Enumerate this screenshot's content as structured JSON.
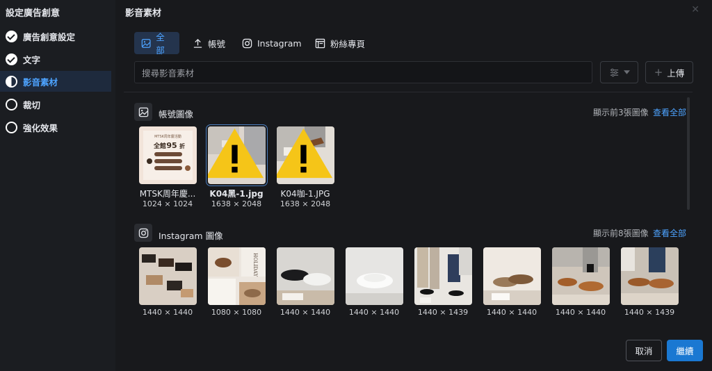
{
  "sidebar": {
    "title": "設定廣告創意",
    "steps": [
      {
        "label": "廣告創意設定",
        "state": "done"
      },
      {
        "label": "文字",
        "state": "done"
      },
      {
        "label": "影音素材",
        "state": "active"
      },
      {
        "label": "裁切",
        "state": "todo"
      },
      {
        "label": "強化效果",
        "state": "todo"
      }
    ]
  },
  "dialog": {
    "title": "影音素材",
    "close_icon": "close-icon",
    "tabs": [
      {
        "label": "全部",
        "icon": "image-icon",
        "active": true
      },
      {
        "label": "帳號",
        "icon": "upload-icon",
        "active": false
      },
      {
        "label": "Instagram",
        "icon": "instagram-icon",
        "active": false
      },
      {
        "label": "粉絲專頁",
        "icon": "page-icon",
        "active": false
      }
    ],
    "search": {
      "placeholder": "搜尋影音素材"
    },
    "filter_icon": "sliders-icon",
    "upload_label": "上傳",
    "accent_color": "#4da3ff",
    "primary_color": "#1a78d2",
    "warning_color": "#f5c518"
  },
  "sections": {
    "account": {
      "title": "帳號圖像",
      "count_text": "顯示前3張圖像",
      "view_all": "查看全部",
      "items": [
        {
          "name": "MTSK周年慶...",
          "dims": "1024 × 1024"
        },
        {
          "name": "K04黑-1.jpg",
          "dims": "1638 × 2048"
        },
        {
          "name": "K04咖-1.JPG",
          "dims": "1638 × 2048"
        }
      ]
    },
    "instagram": {
      "title": "Instagram 圖像",
      "count_text": "顯示前8張圖像",
      "view_all": "查看全部",
      "items": [
        {
          "dims": "1440 × 1440"
        },
        {
          "dims": "1080 × 1080"
        },
        {
          "dims": "1440 × 1440"
        },
        {
          "dims": "1440 × 1440"
        },
        {
          "dims": "1440 × 1439"
        },
        {
          "dims": "1440 × 1440"
        },
        {
          "dims": "1440 × 1440"
        },
        {
          "dims": "1440 × 1439"
        }
      ]
    }
  },
  "promo_thumb": {
    "brand": "MTSK周年慶活動",
    "headline_a": "全館",
    "headline_b": "95",
    "headline_c": "折"
  },
  "ig_thumb_text": "HOLIDAY",
  "footer": {
    "cancel": "取消",
    "continue": "繼續"
  }
}
